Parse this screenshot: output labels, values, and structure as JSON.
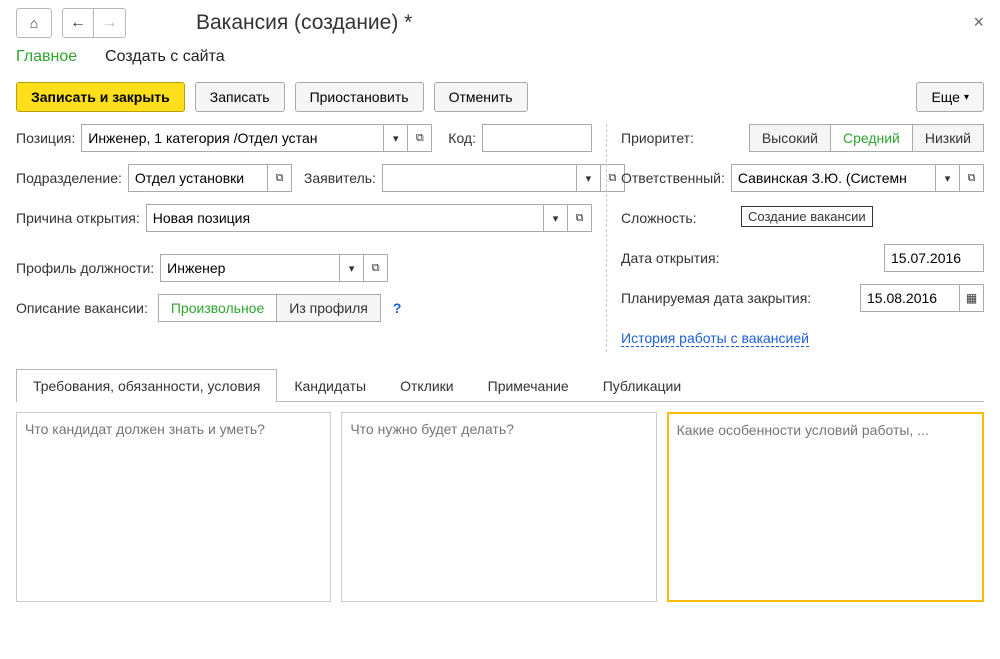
{
  "window": {
    "title": "Вакансия (создание) *"
  },
  "sections": {
    "main": "Главное",
    "from_site": "Создать с сайта"
  },
  "commands": {
    "save_close": "Записать и закрыть",
    "save": "Записать",
    "suspend": "Приостановить",
    "cancel": "Отменить",
    "more": "Еще"
  },
  "left": {
    "position_label": "Позиция:",
    "position_value": "Инженер, 1 категория /Отдел устан",
    "code_label": "Код:",
    "code_value": "",
    "department_label": "Подразделение:",
    "department_value": "Отдел установки",
    "applicant_label": "Заявитель:",
    "applicant_value": "",
    "reason_label": "Причина открытия:",
    "reason_value": "Новая позиция",
    "profile_label": "Профиль должности:",
    "profile_value": "Инженер",
    "desc_label": "Описание вакансии:",
    "desc_free": "Произвольное",
    "desc_profile": "Из профиля",
    "help": "?"
  },
  "right": {
    "priority_label": "Приоритет:",
    "priority_high": "Высокий",
    "priority_mid": "Средний",
    "priority_low": "Низкий",
    "responsible_label": "Ответственный:",
    "responsible_value": "Савинская З.Ю. (Системн",
    "complexity_label": "Сложность:",
    "tooltip": "Создание вакансии",
    "open_date_label": "Дата открытия:",
    "open_date_value": "15.07.2016",
    "close_date_label": "Планируемая дата закрытия:",
    "close_date_value": "15.08.2016",
    "history_link": "История работы с вакансией"
  },
  "tabs": {
    "t1": "Требования, обязанности, условия",
    "t2": "Кандидаты",
    "t3": "Отклики",
    "t4": "Примечание",
    "t5": "Публикации"
  },
  "memos": {
    "p1": "Что кандидат должен знать и уметь?",
    "p2": "Что нужно будет делать?",
    "p3": "Какие особенности условий работы, ..."
  }
}
